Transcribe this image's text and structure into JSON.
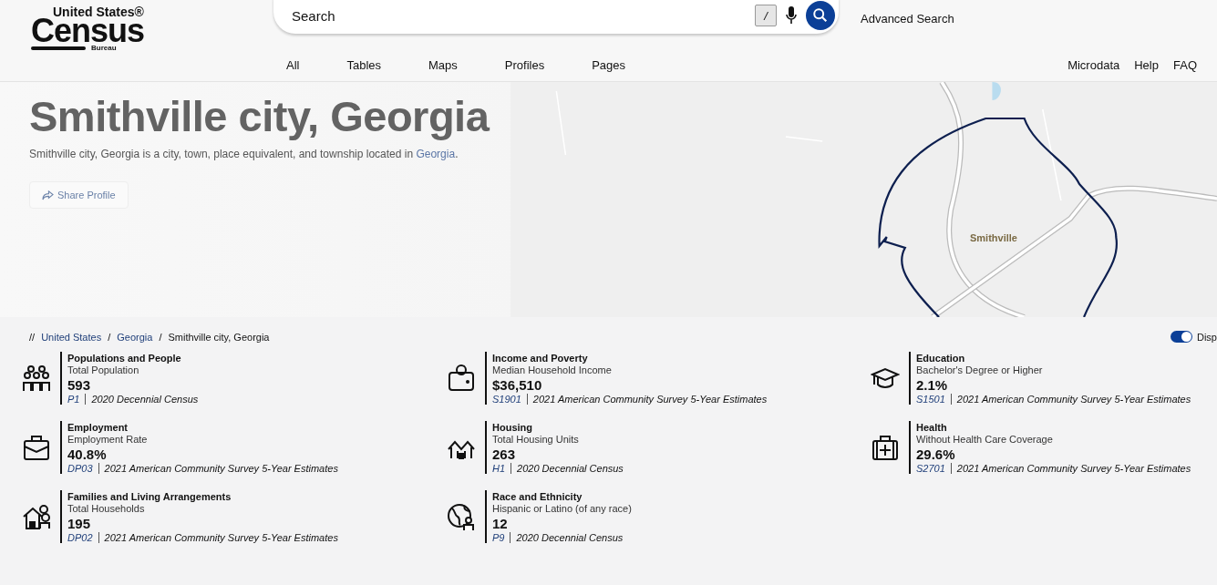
{
  "logo": {
    "top": "United States®",
    "main": "Census",
    "bottom": "Bureau"
  },
  "search": {
    "placeholder": "Search",
    "shortcut": "/",
    "advanced": "Advanced Search"
  },
  "nav": [
    "All",
    "Tables",
    "Maps",
    "Profiles",
    "Pages"
  ],
  "utility_links": [
    "Microdata",
    "Help",
    "FAQ"
  ],
  "hero": {
    "title": "Smithville city, Georgia",
    "description": "Smithville city, Georgia is a city, town, place equivalent, and township located in",
    "description_link": "Georgia",
    "description_end": ".",
    "share": "Share Profile"
  },
  "map": {
    "label": "Smithville"
  },
  "breadcrumb_start": "//",
  "breadcrumb": [
    {
      "label": "United States",
      "link": true
    },
    {
      "label": "Georgia",
      "link": true
    },
    {
      "label": "Smithville city, Georgia",
      "link": false
    }
  ],
  "breadcrumb_separator": "/",
  "toggle": {
    "label": "Disp",
    "on": true
  },
  "stats": [
    {
      "kind": "people",
      "topic": "Populations and People",
      "measure": "Total Population",
      "value": "593",
      "table": "P1",
      "source": "2020 Decennial Census"
    },
    {
      "kind": "income",
      "topic": "Income and Poverty",
      "measure": "Median Household Income",
      "value": "$36,510",
      "table": "S1901",
      "source": "2021 American Community Survey 5-Year Estimates"
    },
    {
      "kind": "education",
      "topic": "Education",
      "measure": "Bachelor's Degree or Higher",
      "value": "2.1%",
      "table": "S1501",
      "source": "2021 American Community Survey 5-Year Estimates"
    },
    {
      "kind": "employment",
      "topic": "Employment",
      "measure": "Employment Rate",
      "value": "40.8%",
      "table": "DP03",
      "source": "2021 American Community Survey 5-Year Estimates"
    },
    {
      "kind": "housing",
      "topic": "Housing",
      "measure": "Total Housing Units",
      "value": "263",
      "table": "H1",
      "source": "2020 Decennial Census"
    },
    {
      "kind": "health",
      "topic": "Health",
      "measure": "Without Health Care Coverage",
      "value": "29.6%",
      "table": "S2701",
      "source": "2021 American Community Survey 5-Year Estimates"
    },
    {
      "kind": "families",
      "topic": "Families and Living Arrangements",
      "measure": "Total Households",
      "value": "195",
      "table": "DP02",
      "source": "2021 American Community Survey 5-Year Estimates"
    },
    {
      "kind": "race",
      "topic": "Race and Ethnicity",
      "measure": "Hispanic or Latino (of any race)",
      "value": "12",
      "table": "P9",
      "source": "2020 Decennial Census"
    }
  ]
}
